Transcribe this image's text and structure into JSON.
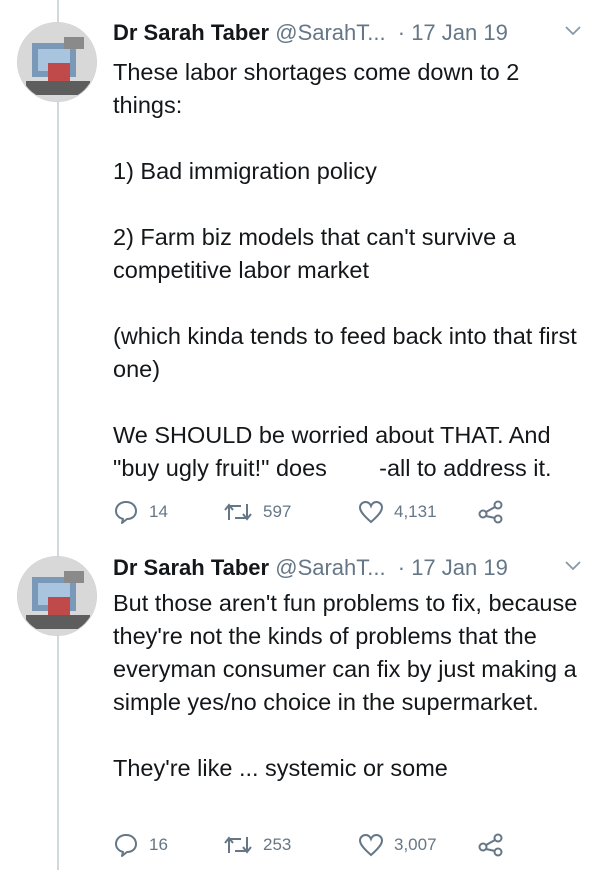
{
  "tweets": [
    {
      "author_name": "Dr Sarah Taber",
      "handle": "@SarahT...",
      "date": "· 17 Jan 19",
      "paragraphs": [
        "These labor shortages come down to 2 things:",
        "1) Bad immigration policy",
        "2) Farm biz models that can't survive a competitive labor market",
        "(which kinda tends to feed back into that first one)",
        "We SHOULD be worried about THAT. And \"buy ugly fruit!\" does        -all to address it."
      ],
      "replies": "14",
      "retweets": "597",
      "likes": "4,131"
    },
    {
      "author_name": "Dr Sarah Taber",
      "handle": "@SarahT...",
      "date": "· 17 Jan 19",
      "paragraphs": [
        "But those aren't fun problems to fix, because they're not the kinds of problems that the everyman consumer can fix by just making a simple yes/no choice in the supermarket.",
        "They're like ... systemic or some"
      ],
      "replies": "16",
      "retweets": "253",
      "likes": "3,007"
    }
  ],
  "icons": {
    "reply": "reply-icon",
    "retweet": "retweet-icon",
    "like": "heart-icon",
    "share": "share-icon",
    "caret": "chevron-down-icon"
  },
  "colors": {
    "text": "#14171a",
    "muted": "#657786",
    "thread_line": "#cfd9de"
  }
}
